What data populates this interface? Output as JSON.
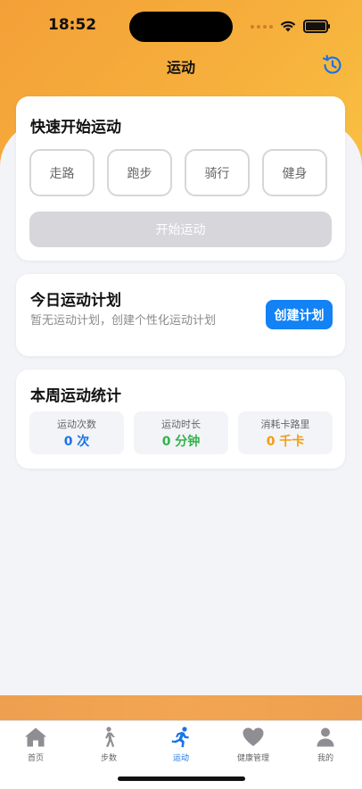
{
  "status_bar": {
    "time": "18:52"
  },
  "header": {
    "title": "运动",
    "history_icon": "history-icon"
  },
  "quick_start": {
    "title": "快速开始运动",
    "sports": [
      "走路",
      "跑步",
      "骑行",
      "健身"
    ],
    "start_label": "开始运动"
  },
  "plan": {
    "title": "今日运动计划",
    "description": "暂无运动计划，创建个性化运动计划",
    "create_label": "创建计划"
  },
  "stats": {
    "title": "本周运动统计",
    "items": [
      {
        "label": "运动次数",
        "value": "0 次",
        "color": "#1a73e8"
      },
      {
        "label": "运动时长",
        "value": "0 分钟",
        "color": "#33b24d"
      },
      {
        "label": "消耗卡路里",
        "value": "0 千卡",
        "color": "#f39c12"
      }
    ]
  },
  "tabbar": {
    "items": [
      {
        "label": "首页",
        "icon": "home-icon"
      },
      {
        "label": "步数",
        "icon": "walk-icon"
      },
      {
        "label": "运动",
        "icon": "run-icon",
        "active": true
      },
      {
        "label": "健康管理",
        "icon": "heart-icon"
      },
      {
        "label": "我的",
        "icon": "person-icon"
      }
    ]
  },
  "colors": {
    "accent": "#1282f5",
    "header_gradient": [
      "#f4a038",
      "#f9c343"
    ],
    "tab_active": "#1a73e8"
  }
}
